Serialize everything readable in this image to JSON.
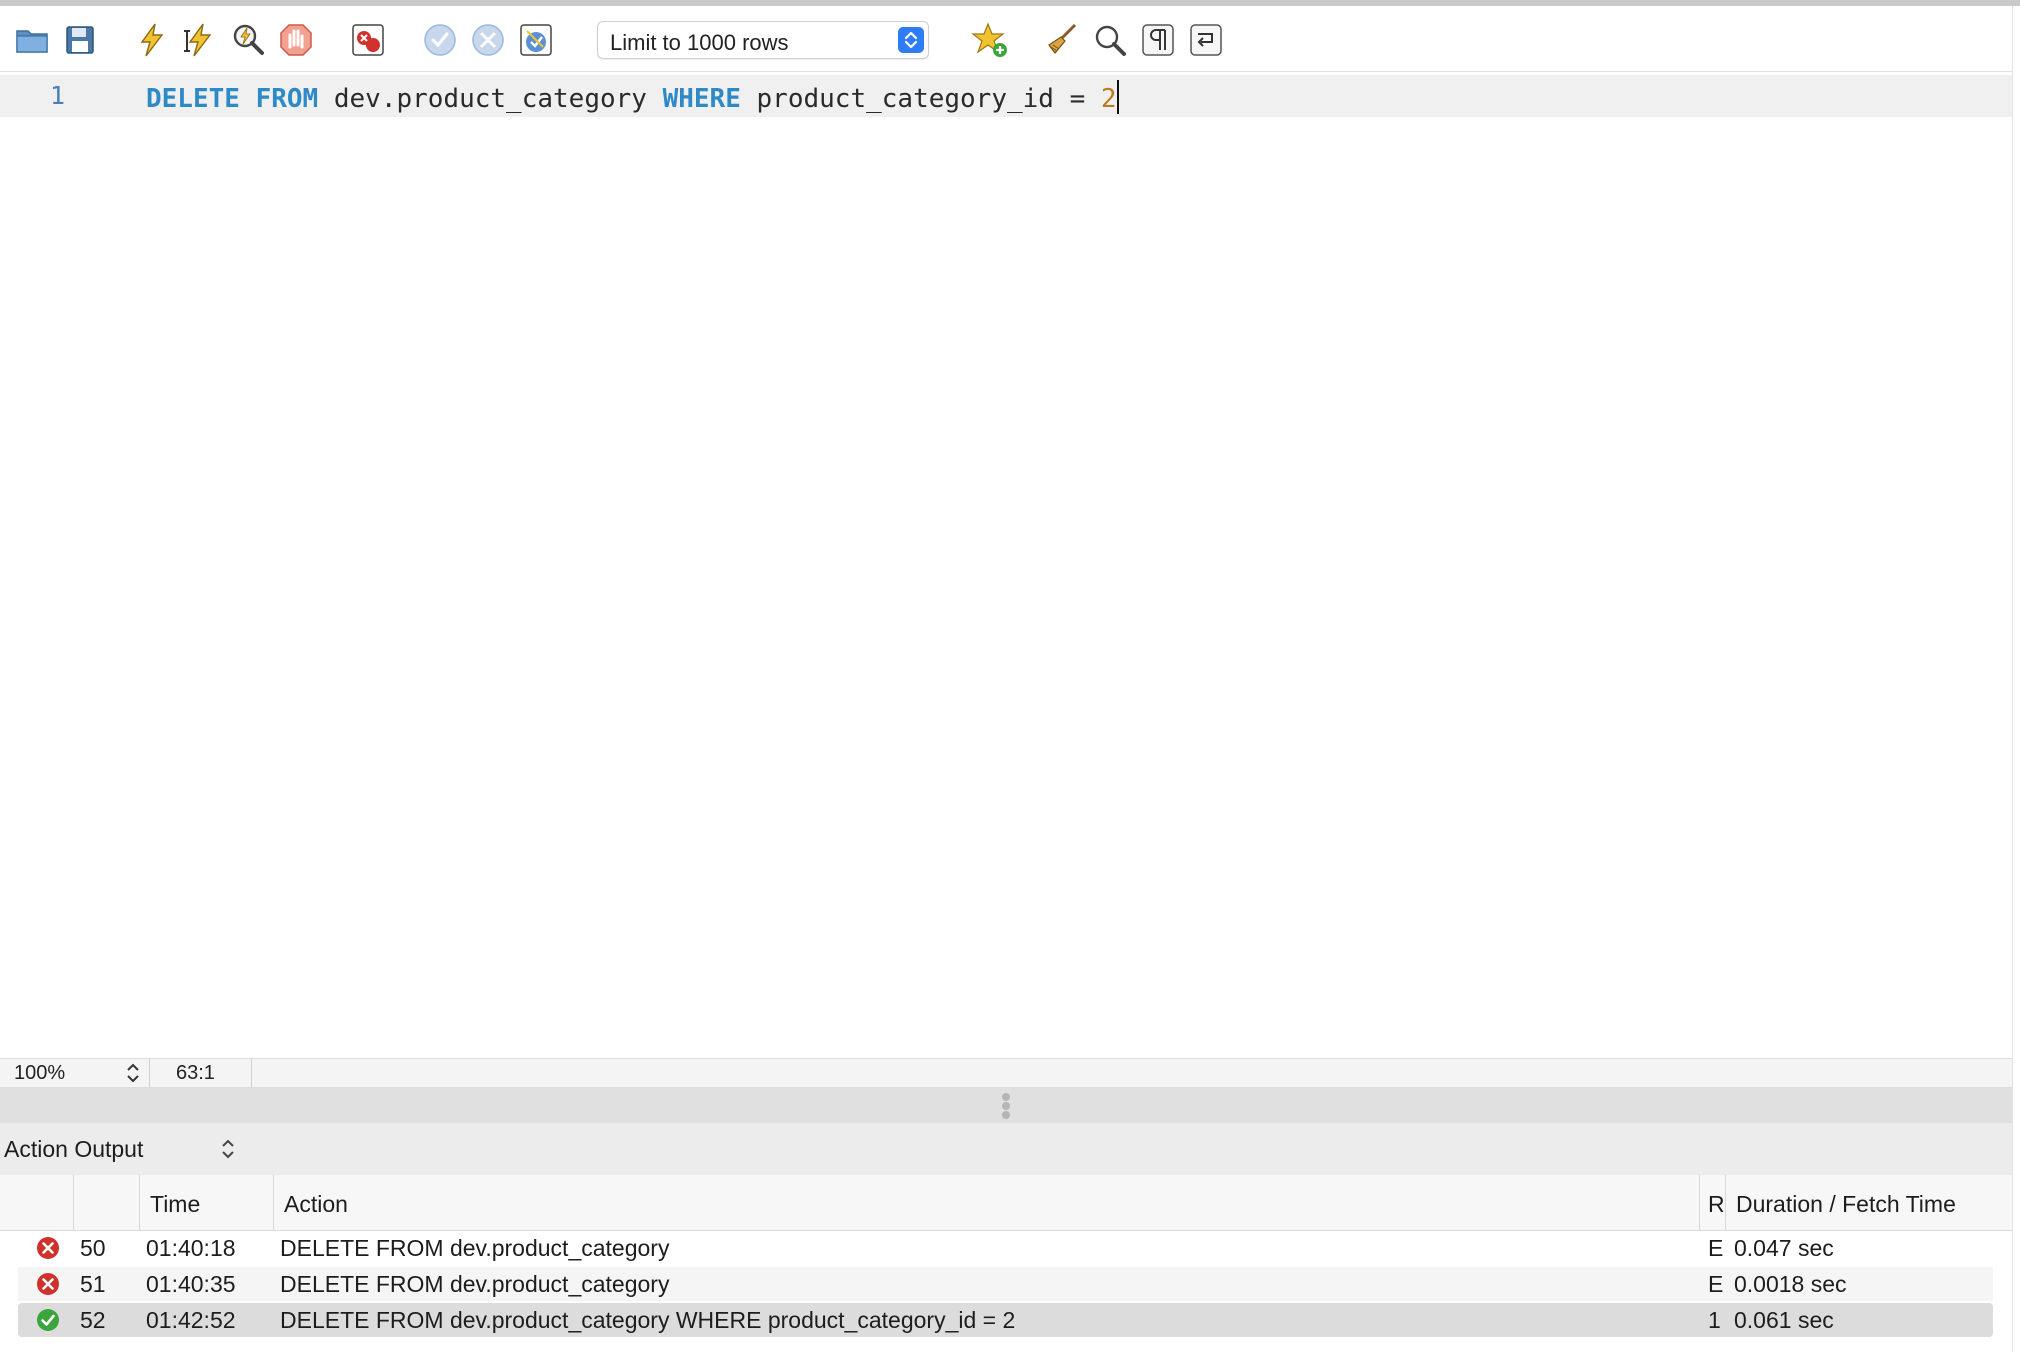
{
  "toolbar": {
    "buttons": [
      {
        "name": "open-file-button",
        "icon": "folder-icon"
      },
      {
        "name": "save-file-button",
        "icon": "floppy-icon"
      },
      {
        "name": "execute-all-button",
        "icon": "lightning-icon"
      },
      {
        "name": "execute-current-button",
        "icon": "lightning-cursor-icon"
      },
      {
        "name": "explain-button",
        "icon": "magnifier-lightning-icon"
      },
      {
        "name": "stop-button",
        "icon": "stop-hand-icon"
      },
      {
        "name": "toggle-error-stop-button",
        "icon": "error-stop-icon"
      },
      {
        "name": "commit-button",
        "icon": "check-circle-icon"
      },
      {
        "name": "rollback-button",
        "icon": "x-circle-icon"
      },
      {
        "name": "autocommit-button",
        "icon": "autocommit-icon"
      },
      {
        "name": "add-snippet-button",
        "icon": "star-plus-icon"
      },
      {
        "name": "beautify-button",
        "icon": "broom-icon"
      },
      {
        "name": "find-button",
        "icon": "magnifier-icon"
      },
      {
        "name": "invisible-chars-button",
        "icon": "pilcrow-icon"
      },
      {
        "name": "word-wrap-button",
        "icon": "wrap-icon"
      }
    ],
    "limit_select": {
      "value": "Limit to 1000 rows"
    }
  },
  "editor": {
    "line_number": "1",
    "tokens": {
      "kw_delete": "DELETE",
      "kw_from": "FROM",
      "table": "dev.product_category",
      "kw_where": "WHERE",
      "column": "product_category_id",
      "op": "=",
      "value": "2"
    }
  },
  "status": {
    "zoom": "100%",
    "cursor_pos": "63:1"
  },
  "output": {
    "panel_title": "Action Output",
    "columns": {
      "time": "Time",
      "action": "Action",
      "response": "R",
      "duration": "Duration / Fetch Time"
    },
    "rows": [
      {
        "status": "error",
        "num": "50",
        "time": "01:40:18",
        "action": "DELETE FROM dev.product_category",
        "response": "E",
        "duration": "0.047 sec"
      },
      {
        "status": "error",
        "num": "51",
        "time": "01:40:35",
        "action": "DELETE FROM dev.product_category",
        "response": "E",
        "duration": "0.0018 sec"
      },
      {
        "status": "success",
        "num": "52",
        "time": "01:42:52",
        "action": "DELETE FROM dev.product_category WHERE product_category_id = 2",
        "response": "1",
        "duration": "0.061 sec"
      }
    ]
  },
  "colors": {
    "keyword": "#2d8ac7",
    "number": "#c2791e",
    "error": "#d0312d",
    "success": "#3aa53a",
    "accent": "#2f7df6"
  }
}
